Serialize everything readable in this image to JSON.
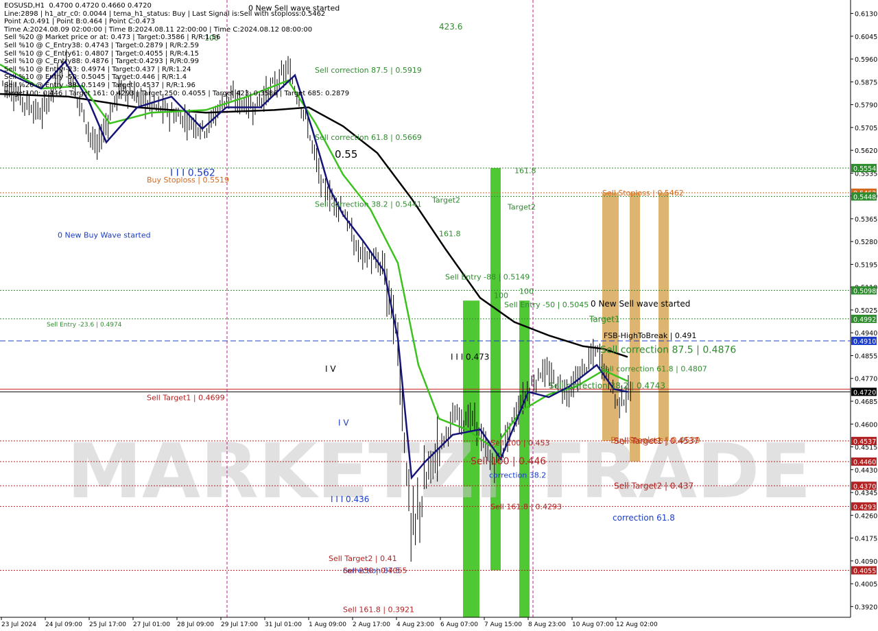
{
  "chart_data": {
    "type": "candlestick",
    "symbol": "EOSUSD,H1",
    "ohlc_header": "EOSUSD,H1  0.4700 0.4720 0.4660 0.4720",
    "ylim": [
      0.388,
      0.618
    ],
    "price_ticks": [
      "0.6130",
      "0.6045",
      "0.5960",
      "0.5875",
      "0.5790",
      "0.5705",
      "0.5620",
      "0.5535",
      "0.5450",
      "0.5365",
      "0.5280",
      "0.5195",
      "0.5110",
      "0.5025",
      "0.4940",
      "0.4855",
      "0.4770",
      "0.4685",
      "0.4600",
      "0.4515",
      "0.4430",
      "0.4345",
      "0.4260",
      "0.4175",
      "0.4090",
      "0.4005",
      "0.3920"
    ],
    "x_ticks": [
      "23 Jul 2024",
      "24 Jul 09:00",
      "25 Jul 17:00",
      "27 Jul 01:00",
      "28 Jul 09:00",
      "29 Jul 17:00",
      "31 Jul 01:00",
      "1 Aug 09:00",
      "2 Aug 17:00",
      "4 Aug 23:00",
      "6 Aug 07:00",
      "7 Aug 15:00",
      "8 Aug 23:00",
      "10 Aug 07:00",
      "12 Aug 02:00"
    ],
    "info_lines": [
      "EOSUSD,H1  0.4700 0.4720 0.4660 0.4720",
      "Line:2898 | h1_atr_c0: 0.0044 | tema_h1_status: Buy | Last Signal is:Sell with stoploss:0.5462",
      "Point A:0.491 | Point B:0.464 | Point C:0.473",
      "Time A:2024.08.09 02:00:00 | Time B:2024.08.11 22:00:00 | Time C:2024.08.12 08:00:00",
      "Sell %20 @ Market price or at: 0.473 | Target:0.3586 | R/R:1.56",
      "Sell %10 @ C_Entry38: 0.4743 | Target:0.2879 | R/R:2.59",
      "Sell %10 @ C_Entry61: 0.4807 | Target:0.4055 | R/R:4.15",
      "Sell %10 @ C_Entry88: 0.4876 | Target:0.4293 | R/R:0.99",
      "Sell %10 @ Entry -23: 0.4974 | Target:0.437 | R/R:1.24",
      "Sell %10 @ Entry -50: 0.5045 | Target:0.446 | R/R:1.4",
      "Sell %20 @ Entry -88: 0.5149 | Target:0.4537 | R/R:1.96",
      "Target100: 0.446 | Target 161: 0.4293 | Target 250: 0.4055 | Target 423: 0.3586 | Target 685: 0.2879"
    ],
    "horizontal_levels": [
      {
        "label": "0.5554",
        "price": 0.5554,
        "color": "#2e8b2e",
        "style": "dotted"
      },
      {
        "label": "0.5462",
        "price": 0.5462,
        "color": "#d2691e",
        "style": "dotted"
      },
      {
        "label": "0.5448",
        "price": 0.5448,
        "color": "#2e8b2e",
        "style": "dotted"
      },
      {
        "label": "0.5098",
        "price": 0.5098,
        "color": "#2e8b2e",
        "style": "dotted"
      },
      {
        "label": "0.4992",
        "price": 0.4992,
        "color": "#2e8b2e",
        "style": "dotted"
      },
      {
        "label": "0.4910",
        "price": 0.491,
        "color": "#1a3cc8",
        "style": "dashed"
      },
      {
        "label": "0.4720",
        "price": 0.472,
        "color": "#000000",
        "style": "solid"
      },
      {
        "label": "0.4537",
        "price": 0.4537,
        "color": "#b22222",
        "style": "dotted"
      },
      {
        "label": "0.4460",
        "price": 0.446,
        "color": "#b22222",
        "style": "dotted"
      },
      {
        "label": "0.4370",
        "price": 0.437,
        "color": "#b22222",
        "style": "dotted"
      },
      {
        "label": "0.4293",
        "price": 0.4293,
        "color": "#b22222",
        "style": "dotted"
      },
      {
        "label": "0.4055",
        "price": 0.4055,
        "color": "#b22222",
        "style": "dotted"
      }
    ],
    "current_price_marker": "0.4725",
    "annotations": [
      {
        "text": "0 New Sell wave started",
        "price": 0.615,
        "color": "#000000"
      },
      {
        "text": "423.6",
        "price": 0.608,
        "color": "#2e8b2e"
      },
      {
        "text": "100",
        "price": 0.604,
        "color": "#2e8b2e"
      },
      {
        "text": "Sell correction 87.5 | 0.5919",
        "price": 0.5919,
        "color": "#2e8b2e"
      },
      {
        "text": "Sell correction 61.8 | 0.5669",
        "price": 0.5669,
        "color": "#2e8b2e"
      },
      {
        "text": "0.55",
        "price": 0.5602,
        "color": "#000000"
      },
      {
        "text": "I I I 0.562",
        "price": 0.5535,
        "color": "#1a3cc8"
      },
      {
        "text": "Buy Stoploss | 0.5519",
        "price": 0.551,
        "color": "#d2691e"
      },
      {
        "text": "Sell correction 38.2 | 0.5441",
        "price": 0.542,
        "color": "#2e8b2e"
      },
      {
        "text": "161.8",
        "price": 0.5545,
        "color": "#2e8b2e"
      },
      {
        "text": "Target2",
        "price": 0.5435,
        "color": "#2e8b2e"
      },
      {
        "text": "Target2",
        "price": 0.541,
        "color": "#2e8b2e"
      },
      {
        "text": "161.8",
        "price": 0.531,
        "color": "#2e8b2e"
      },
      {
        "text": "0 New Buy Wave started",
        "price": 0.5305,
        "color": "#1a3cc8"
      },
      {
        "text": "Sell Stoploss | 0.5462",
        "price": 0.5462,
        "color": "#d2691e"
      },
      {
        "text": "Sell Entry -88 | 0.5149",
        "price": 0.5149,
        "color": "#2e8b2e"
      },
      {
        "text": "100",
        "price": 0.5095,
        "color": "#2e8b2e"
      },
      {
        "text": "100",
        "price": 0.508,
        "color": "#2e8b2e"
      },
      {
        "text": "0 New Sell wave started",
        "price": 0.5048,
        "color": "#000000"
      },
      {
        "text": "Sell Entry -50 | 0.5045",
        "price": 0.5045,
        "color": "#2e8b2e"
      },
      {
        "text": "Target1",
        "price": 0.499,
        "color": "#2e8b2e"
      },
      {
        "text": "Sell Entry -23.6 | 0.4974",
        "price": 0.4974,
        "color": "#2e8b2e"
      },
      {
        "text": "FSB-HighToBreak | 0.491",
        "price": 0.493,
        "color": "#000000"
      },
      {
        "text": "Sell correction 87.5 | 0.4876",
        "price": 0.4876,
        "color": "#2e8b2e"
      },
      {
        "text": "I I I 0.473",
        "price": 0.485,
        "color": "#000000"
      },
      {
        "text": "Sell correction 61.8 | 0.4807",
        "price": 0.4807,
        "color": "#2e8b2e"
      },
      {
        "text": "I V",
        "price": 0.4805,
        "color": "#000000"
      },
      {
        "text": "Sell correction 38.2 | 0.4743",
        "price": 0.4743,
        "color": "#2e8b2e"
      },
      {
        "text": "Sell Target1 | 0.4699",
        "price": 0.4699,
        "color": "#b22222"
      },
      {
        "text": "I V",
        "price": 0.4605,
        "color": "#1a3cc8"
      },
      {
        "text": "Buy Stoploss | 0.4539",
        "price": 0.4539,
        "color": "#d2691e"
      },
      {
        "text": "Sell 100 | 0.453",
        "price": 0.453,
        "color": "#b22222"
      },
      {
        "text": "Sell Target1 | 0.4537",
        "price": 0.4537,
        "color": "#b22222"
      },
      {
        "text": "Sell 100 | 0.446",
        "price": 0.446,
        "color": "#b22222"
      },
      {
        "text": "correction 38.2",
        "price": 0.441,
        "color": "#1a3cc8"
      },
      {
        "text": "Sell Target2 | 0.437",
        "price": 0.437,
        "color": "#b22222"
      },
      {
        "text": "I I I 0.436",
        "price": 0.432,
        "color": "#1a3cc8"
      },
      {
        "text": "Sell 161.8 | 0.4293",
        "price": 0.4293,
        "color": "#b22222"
      },
      {
        "text": "correction 61.8",
        "price": 0.425,
        "color": "#1a3cc8"
      },
      {
        "text": "Sell Target2 | 0.41",
        "price": 0.41,
        "color": "#b22222"
      },
      {
        "text": "correction 87.5",
        "price": 0.4055,
        "color": "#1a3cc8"
      },
      {
        "text": "Sell 250 | 0.4055",
        "price": 0.4055,
        "color": "#b22222"
      },
      {
        "text": "Sell 161.8 | 0.3921",
        "price": 0.391,
        "color": "#b22222"
      }
    ],
    "vertical_lines": [
      {
        "x_label": "29 Jul 17:00",
        "color": "#c2188a"
      },
      {
        "x_label": "8 Aug 23:00",
        "color": "#c2188a"
      }
    ],
    "zones": [
      {
        "name": "target-zone-1",
        "color": "#3cc21e",
        "from": 0.388,
        "to": 0.506
      },
      {
        "name": "target-zone-2",
        "color": "#3cc21e",
        "from": 0.4055,
        "to": 0.5554
      },
      {
        "name": "target-zone-3",
        "color": "#3cc21e",
        "from": 0.388,
        "to": 0.506
      },
      {
        "name": "sell-zone-1",
        "color": "#d4a24c",
        "from": 0.4537,
        "to": 0.5462
      },
      {
        "name": "sell-zone-2",
        "color": "#d4a24c",
        "from": 0.446,
        "to": 0.5462
      },
      {
        "name": "sell-zone-3",
        "color": "#d4a24c",
        "from": 0.4537,
        "to": 0.5462
      }
    ],
    "watermark": "MARKETZI TRADE"
  }
}
